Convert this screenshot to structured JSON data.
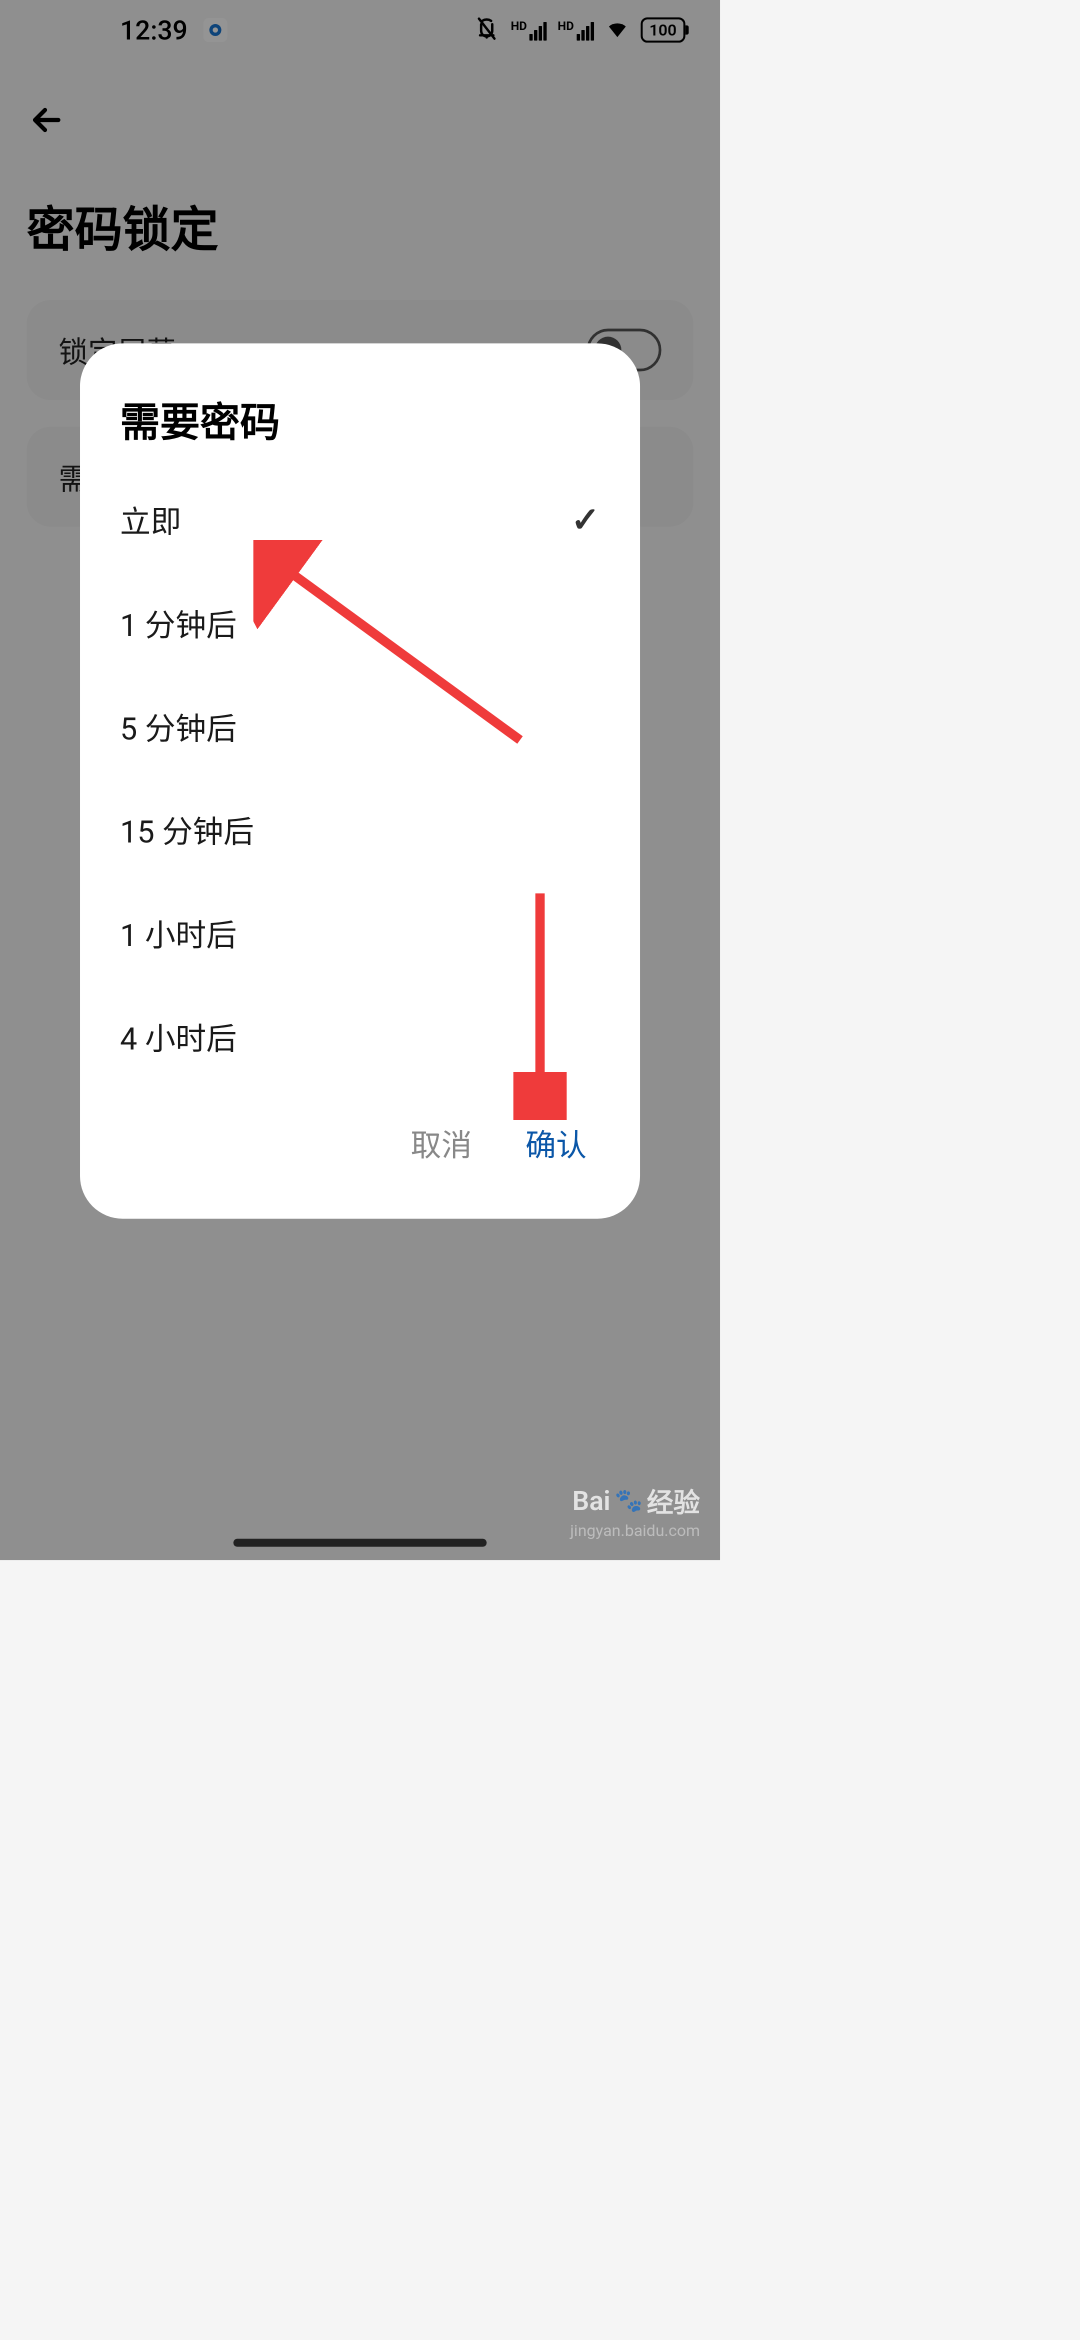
{
  "statusBar": {
    "time": "12:39",
    "battery": "100"
  },
  "page": {
    "title": "密码锁定"
  },
  "settings": {
    "lockScreen": {
      "label": "锁定屏幕"
    },
    "requirePassword": {
      "labelPartial": "需"
    }
  },
  "dialog": {
    "title": "需要密码",
    "options": [
      {
        "label": "立即",
        "selected": true
      },
      {
        "label": "1 分钟后",
        "selected": false
      },
      {
        "label": "5 分钟后",
        "selected": false
      },
      {
        "label": "15 分钟后",
        "selected": false
      },
      {
        "label": "1 小时后",
        "selected": false
      },
      {
        "label": "4 小时后",
        "selected": false
      }
    ],
    "cancel": "取消",
    "confirm": "确认"
  },
  "annotation": {
    "arrowColor": "#ef3b3b"
  },
  "watermark": {
    "brand": "Bai",
    "brand2": "经验",
    "sub": "jingyan.baidu.com"
  }
}
